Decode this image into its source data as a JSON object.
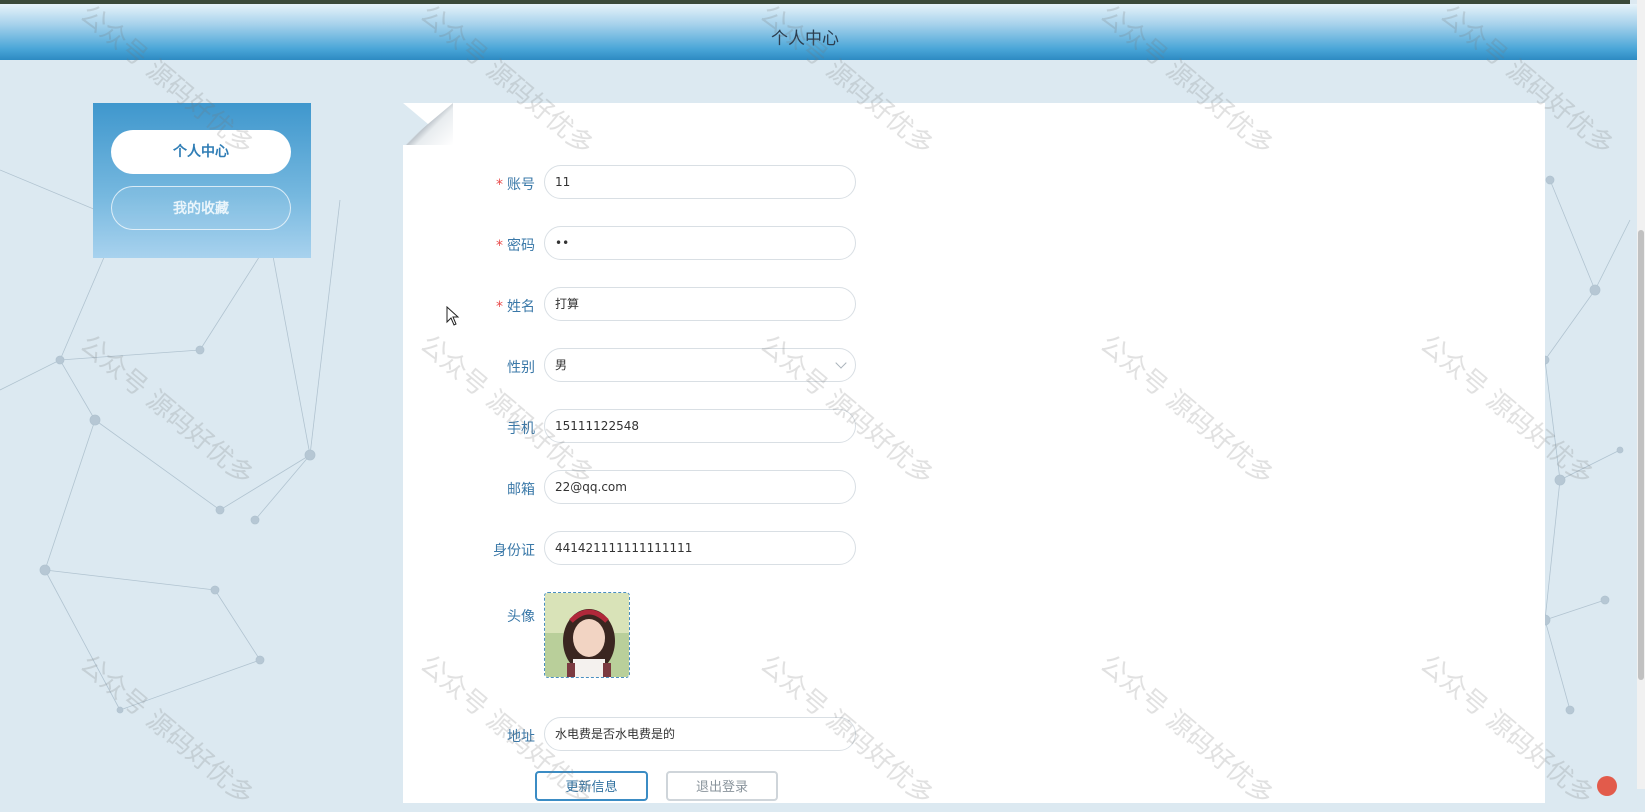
{
  "header": {
    "title": "个人中心"
  },
  "sidebar": {
    "items": [
      {
        "label": "个人中心",
        "active": true
      },
      {
        "label": "我的收藏",
        "active": false
      }
    ]
  },
  "form": {
    "fields": [
      {
        "key": "account",
        "label": "账号",
        "required": true,
        "value": "11",
        "type": "text"
      },
      {
        "key": "password",
        "label": "密码",
        "required": true,
        "value": "••",
        "type": "password"
      },
      {
        "key": "name",
        "label": "姓名",
        "required": true,
        "value": "打算",
        "type": "text"
      },
      {
        "key": "gender",
        "label": "性别",
        "required": false,
        "value": "男",
        "type": "select"
      },
      {
        "key": "phone",
        "label": "手机",
        "required": false,
        "value": "15111122548",
        "type": "text"
      },
      {
        "key": "email",
        "label": "邮箱",
        "required": false,
        "value": "22@qq.com",
        "type": "text"
      },
      {
        "key": "idcard",
        "label": "身份证",
        "required": false,
        "value": "441421111111111111",
        "type": "text"
      },
      {
        "key": "address",
        "label": "地址",
        "required": false,
        "value": "水电费是否水电费是的",
        "type": "text"
      }
    ],
    "avatar_label": "头像",
    "required_mark": "*",
    "buttons": {
      "update": "更新信息",
      "logout": "退出登录"
    }
  },
  "watermark": "公众号 源码好优多",
  "colors": {
    "accent": "#3b8cc4",
    "label": "#3a78a8",
    "required": "#e84a4a",
    "header": "#2d8ac2"
  }
}
